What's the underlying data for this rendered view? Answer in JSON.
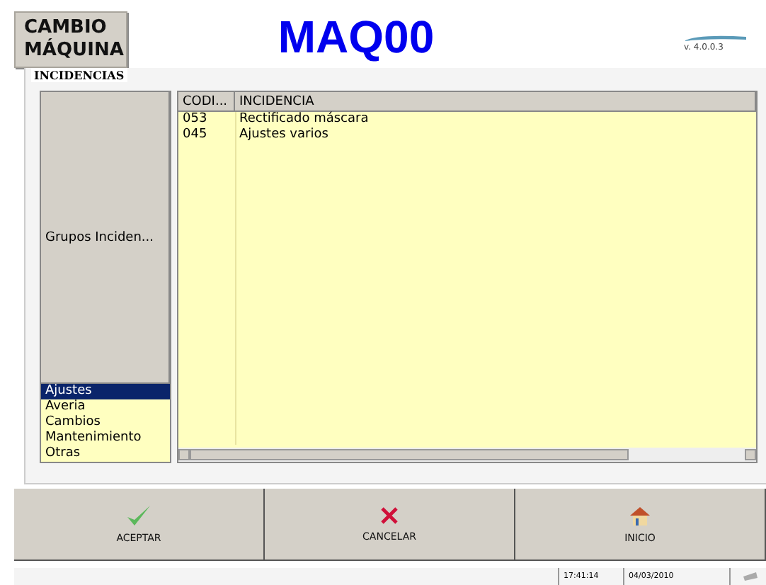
{
  "header": {
    "mode_button": "CAMBIO\nMÁQUINA",
    "title": "MAQ00",
    "version": "v. 4.0.0.3"
  },
  "panel": {
    "title": "INCIDENCIAS"
  },
  "groups": {
    "column": "Grupos Inciden...",
    "items": [
      {
        "label": "Ajustes",
        "selected": true
      },
      {
        "label": "Averia",
        "selected": false
      },
      {
        "label": "Cambios",
        "selected": false
      },
      {
        "label": "Mantenimiento",
        "selected": false
      },
      {
        "label": "Otras",
        "selected": false
      }
    ]
  },
  "incidents": {
    "columns": [
      "CODI...",
      "INCIDENCIA"
    ],
    "rows": [
      {
        "code": "053",
        "name": "Rectificado máscara",
        "selected": false
      },
      {
        "code": "045",
        "name": "Ajustes varios",
        "selected": false
      }
    ]
  },
  "buttons": [
    {
      "kind": "accept",
      "label": "ACEPTAR"
    },
    {
      "kind": "cancel",
      "label": "CANCELAR"
    },
    {
      "kind": "home",
      "label": "INICIO"
    }
  ],
  "status_bar": {
    "time": "17:41:14",
    "date": "04/03/2010"
  }
}
